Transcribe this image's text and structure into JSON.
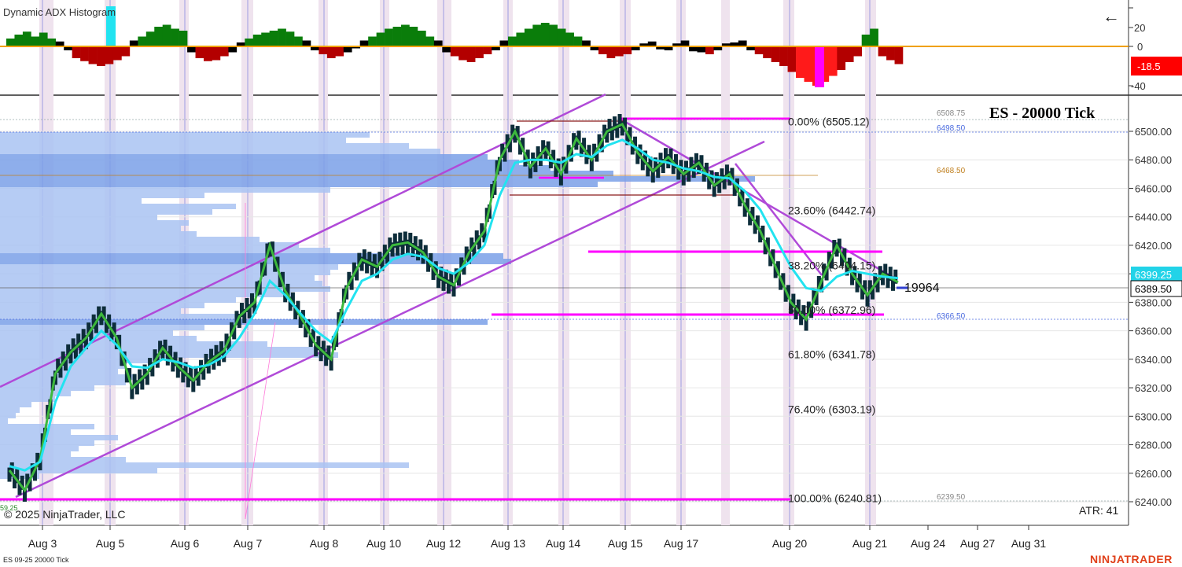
{
  "indicator": {
    "title": "Dynamic ADX Histogram",
    "current_value": "-18.5",
    "ticks": [
      "20",
      "0",
      "-40"
    ],
    "colors": {
      "positive": "#0a7d0a",
      "negative": "#b30000",
      "strong_neg": "#ff1a1a",
      "neutral": "#000000",
      "zero_line": "#f0a000"
    }
  },
  "chart": {
    "title": "ES - 20000 Tick",
    "copyright": "© 2025 NinjaTrader, LLC",
    "instrument_label": "ES 09-25 20000 Tick",
    "brand": "NINJATRADER",
    "atr": "ATR: 41",
    "last_price": "6389.50",
    "ask_price": "6399.25",
    "bar_counter": "19964",
    "low_label": "59.25",
    "back_arrow": "arrow-left-icon"
  },
  "levels_right": [
    "6508.75",
    "6498.50",
    "6468.50",
    "6366.50",
    "6239.50"
  ],
  "fib_levels": [
    {
      "label": "0.00% (6505.12)",
      "price": 6505.12
    },
    {
      "label": "23.60% (6442.74)",
      "price": 6442.74
    },
    {
      "label": "38.20% (6404.15)",
      "price": 6404.15
    },
    {
      "label": "50.00% (6372.96)",
      "price": 6372.96
    },
    {
      "label": "61.80% (6341.78)",
      "price": 6341.78
    },
    {
      "label": "76.40% (6303.19)",
      "price": 6303.19
    },
    {
      "label": "100.00% (6240.81)",
      "price": 6240.81
    }
  ],
  "chart_data": {
    "type": "line",
    "title": "ES - 20000 Tick",
    "x": [
      "Aug 3",
      "Aug 5",
      "Aug 6",
      "Aug 7",
      "Aug 8",
      "Aug 10",
      "Aug 12",
      "Aug 13",
      "Aug 14",
      "Aug 15",
      "Aug 17",
      "Aug 20",
      "Aug 21",
      "Aug 24",
      "Aug 27",
      "Aug 31"
    ],
    "yticks": [
      6500,
      6480,
      6460,
      6440,
      6420,
      6400,
      6380,
      6360,
      6340,
      6320,
      6300,
      6280,
      6260,
      6240
    ],
    "ylim": [
      6225,
      6515
    ],
    "series": [
      {
        "values": [
          6262,
          6248,
          6270,
          6330,
          6345,
          6355,
          6372,
          6355,
          6320,
          6330,
          6348,
          6335,
          6325,
          6338,
          6346,
          6370,
          6380,
          6420,
          6388,
          6370,
          6350,
          6340,
          6390,
          6410,
          6405,
          6420,
          6422,
          6415,
          6398,
          6392,
          6415,
          6430,
          6480,
          6500,
          6475,
          6488,
          6470,
          6495,
          6480,
          6500,
          6505,
          6485,
          6472,
          6482,
          6470,
          6478,
          6462,
          6470,
          6448,
          6430,
          6405,
          6380,
          6368,
          6395,
          6420,
          6400,
          6385,
          6400,
          6394
        ]
      },
      {
        "values": [
          6265,
          6262,
          6268,
          6310,
          6335,
          6348,
          6360,
          6350,
          6335,
          6334,
          6340,
          6338,
          6334,
          6336,
          6342,
          6355,
          6372,
          6395,
          6385,
          6372,
          6360,
          6352,
          6375,
          6395,
          6400,
          6410,
          6414,
          6412,
          6404,
          6400,
          6408,
          6420,
          6455,
          6478,
          6480,
          6480,
          6478,
          6484,
          6482,
          6490,
          6494,
          6488,
          6480,
          6478,
          6474,
          6472,
          6468,
          6467,
          6458,
          6445,
          6425,
          6405,
          6390,
          6388,
          6398,
          6402,
          6400,
          6398,
          6397
        ]
      }
    ],
    "hist": [
      8,
      12,
      15,
      10,
      14,
      8,
      5,
      -4,
      -12,
      -15,
      -18,
      -20,
      -18,
      -14,
      -10,
      6,
      10,
      15,
      20,
      22,
      18,
      16,
      -6,
      -12,
      -15,
      -14,
      -10,
      -6,
      4,
      8,
      12,
      14,
      16,
      18,
      15,
      10,
      6,
      -4,
      -8,
      -12,
      -10,
      -6,
      -2,
      6,
      10,
      14,
      18,
      20,
      22,
      20,
      16,
      10,
      6,
      -6,
      -10,
      -14,
      -16,
      -12,
      -8,
      -4,
      6,
      10,
      14,
      18,
      22,
      24,
      22,
      18,
      14,
      10,
      6,
      -4,
      -8,
      -12,
      -10,
      -8,
      -4,
      3,
      5,
      -3,
      -4,
      3,
      6,
      -5,
      -6,
      -8,
      -4,
      3,
      4,
      6,
      -4,
      -8,
      -12,
      -16,
      -20,
      -26,
      -32,
      -36,
      -40,
      -36,
      -30,
      -24,
      -16,
      -10,
      12,
      18,
      -10,
      -14,
      -18
    ]
  }
}
